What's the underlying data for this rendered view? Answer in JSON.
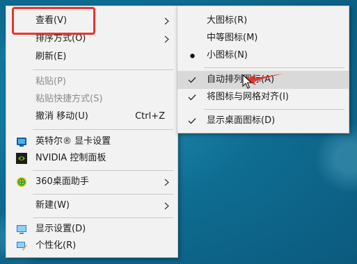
{
  "context_menu": {
    "items": [
      {
        "label": "查看(V)",
        "has_submenu": true
      },
      {
        "label": "排序方式(O)",
        "has_submenu": true
      },
      {
        "label": "刷新(E)"
      },
      {
        "label": "粘贴(P)",
        "disabled": true
      },
      {
        "label": "粘贴快捷方式(S)",
        "disabled": true
      },
      {
        "label": "撤消 移动(U)",
        "shortcut": "Ctrl+Z"
      },
      {
        "label": "英特尔® 显卡设置",
        "icon": "intel-graphics-icon"
      },
      {
        "label": "NVIDIA 控制面板",
        "icon": "nvidia-icon"
      },
      {
        "label": "360桌面助手",
        "icon": "360-icon",
        "has_submenu": true
      },
      {
        "label": "新建(W)",
        "has_submenu": true
      },
      {
        "label": "显示设置(D)",
        "icon": "display-icon"
      },
      {
        "label": "个性化(R)",
        "icon": "personalize-icon"
      }
    ]
  },
  "view_submenu": {
    "items": [
      {
        "label": "大图标(R)"
      },
      {
        "label": "中等图标(M)"
      },
      {
        "label": "小图标(N)",
        "selected": true
      },
      {
        "label": "自动排列图标(A)",
        "checked": true,
        "highlighted": true
      },
      {
        "label": "将图标与网格对齐(I)",
        "checked": true
      },
      {
        "label": "显示桌面图标(D)",
        "checked": true
      }
    ]
  },
  "annotations": {
    "highlight_box_color": "#e8332d",
    "arrow_color": "#e8332d"
  }
}
